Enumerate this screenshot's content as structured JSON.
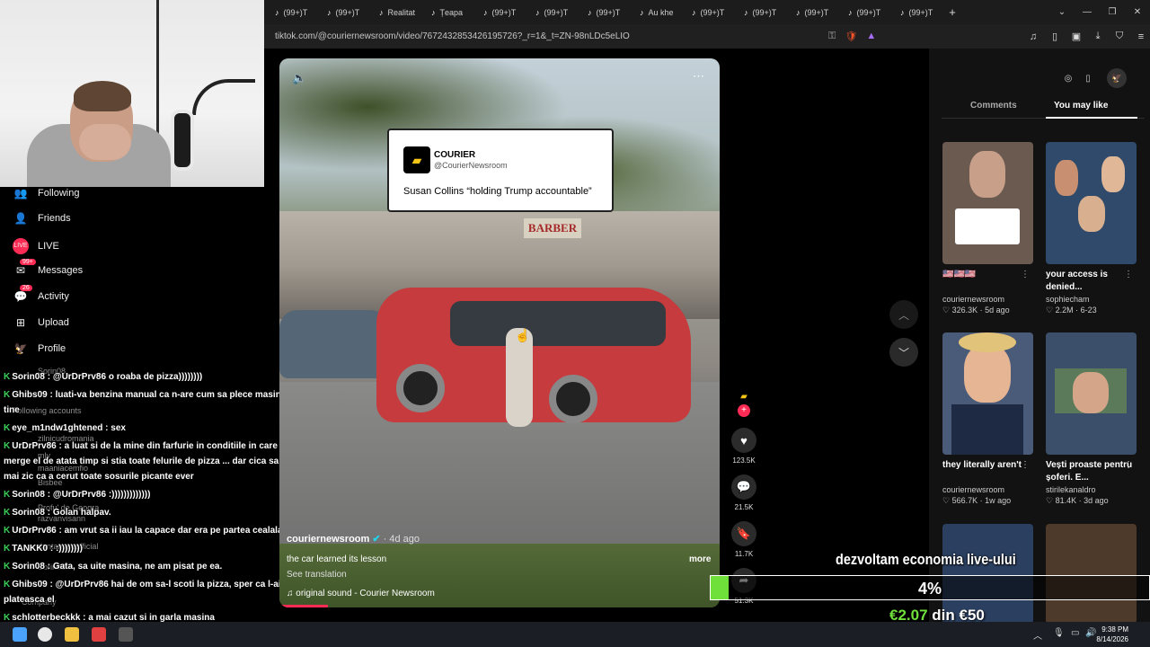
{
  "browser": {
    "tabs": [
      {
        "icon": "♪",
        "label": "(99+)T"
      },
      {
        "icon": "♪",
        "label": "(99+)T"
      },
      {
        "icon": "♪",
        "label": "Realitat"
      },
      {
        "icon": "♪",
        "label": "Țeapa"
      },
      {
        "icon": "♪",
        "label": "(99+)T"
      },
      {
        "icon": "♪",
        "label": "(99+)T"
      },
      {
        "icon": "♪",
        "label": "(99+)T"
      },
      {
        "icon": "♪",
        "label": "Au khe"
      },
      {
        "icon": "♪",
        "label": "(99+)T"
      },
      {
        "icon": "♪",
        "label": "(99+)T"
      },
      {
        "icon": "♪",
        "label": "(99+)T"
      },
      {
        "icon": "♪",
        "label": "(99+)T"
      },
      {
        "icon": "♪",
        "label": "(99+)T"
      }
    ],
    "url": "tiktok.com/@couriernewsroom/video/7672432853426195726?_r=1&_t=ZN-98nLDc5eLIO"
  },
  "nav": {
    "items": [
      {
        "label": "Following",
        "icon": "following-icon"
      },
      {
        "label": "Friends",
        "icon": "friends-icon"
      },
      {
        "label": "LIVE",
        "icon": "live-icon"
      },
      {
        "label": "Messages",
        "icon": "messages-icon",
        "badge": "99+"
      },
      {
        "label": "Activity",
        "icon": "activity-icon",
        "badge": "26"
      },
      {
        "label": "Upload",
        "icon": "upload-icon"
      },
      {
        "label": "Profile",
        "icon": "profile-icon"
      }
    ],
    "following_accounts_label": "Following accounts",
    "ghost_accounts": [
      "zilnicudromania",
      "mly",
      "maaniacemfio",
      "Bisbee",
      "Profu' de Geogra",
      "razvanvisann",
      "dantanaseofficial",
      "Sorin08",
      "Sorin08",
      "Company"
    ]
  },
  "chat": [
    {
      "user": "Sorin08",
      "text": "@UrDrPrv86 o roaba de pizza))))))))"
    },
    {
      "user": "Ghibs09",
      "text": "luati-va benzina manual ca n-are cum sa plece masina de langa"
    },
    {
      "user": "",
      "text": "tine"
    },
    {
      "user": "eye_m1ndw1ghtened",
      "text": "sex"
    },
    {
      "user": "UrDrPrv86",
      "text": "a luat si de la mine din farfurie in conditiile in care m-a dus unde"
    },
    {
      "user": "",
      "text": "merge el de atata timp si stia toate felurile de pizza ... dar cica sa guste ca sa nu"
    },
    {
      "user": "",
      "text": "mai zic ca a cerut toate sosurile picante ever"
    },
    {
      "user": "Sorin08",
      "text": "@UrDrPrv86 :)))))))))))))"
    },
    {
      "user": "Sorin08",
      "text": "Golan halpav."
    },
    {
      "user": "UrDrPrv86",
      "text": "am vrut sa ii iau la capace dar era pe partea cealalata a mesei ..."
    },
    {
      "user": "TANKK0",
      "text": ":))))))))"
    },
    {
      "user": "Sorin08",
      "text": "Gata, sa uite masina, ne am pisat pe ea."
    },
    {
      "user": "Ghibs09",
      "text": "@UrDrPrv86 hai de om sa-l scoti la pizza, sper ca l-ai pus sa"
    },
    {
      "user": "",
      "text": "plateasca el"
    },
    {
      "user": "schlotterbeckkk",
      "text": "a mai cazut si in garla masina"
    },
    {
      "user": "schlotterbeckkk",
      "text": "hahahaha"
    }
  ],
  "video": {
    "tweet": {
      "name": "COURIER",
      "handle": "@CourierNewsroom",
      "text": "Susan Collins “holding Trump accountable”"
    },
    "sign": "BARBER",
    "author": "couriernewsroom",
    "date": "· 4d ago",
    "caption": "the car learned its lesson",
    "translate": "See translation",
    "sound": "♫  original sound - Courier Newsroom",
    "more": "more",
    "progress": 0.11
  },
  "actions": {
    "likes": "123.5K",
    "comments": "21.5K",
    "saves": "11.7K",
    "shares": "51.3K"
  },
  "panel": {
    "tabs": [
      "Comments",
      "You may like"
    ],
    "active_tab": "You may like",
    "cards": [
      {
        "title": "🇺🇸🇺🇸🇺🇸",
        "author": "couriernewsroom",
        "meta": "♡ 326.3K · 5d ago",
        "bg": "#6b5a50"
      },
      {
        "title": "your access is denied...",
        "author": "sophiecham",
        "meta": "♡ 2.2M · 6-23",
        "bg": "#2f4a6a"
      },
      {
        "title": "they literally aren't",
        "author": "couriernewsroom",
        "meta": "♡ 566.7K · 1w ago",
        "bg": "#4a5b7a"
      },
      {
        "title": "Vești proaste pentru șoferi. E...",
        "author": "stirilekanaldro",
        "meta": "♡ 81.4K · 3d ago",
        "bg": "#3b4f6b"
      },
      {
        "title": "",
        "author": "",
        "meta": "",
        "bg": "#2b3f60"
      },
      {
        "title": "",
        "author": "",
        "meta": "",
        "bg": "#4d3a2a"
      }
    ]
  },
  "goal": {
    "title": "dezvoltam economia live-ului",
    "percent_label": "4%",
    "percent": 4,
    "current": "€2.07",
    "separator": " din ",
    "target": "€50"
  },
  "taskbar": {
    "time": "9:38 PM",
    "date": "8/14/2026"
  },
  "colors": {
    "accent": "#fe2c55",
    "goal_green": "#6fe03a",
    "chat_badge": "#3cd05a"
  }
}
